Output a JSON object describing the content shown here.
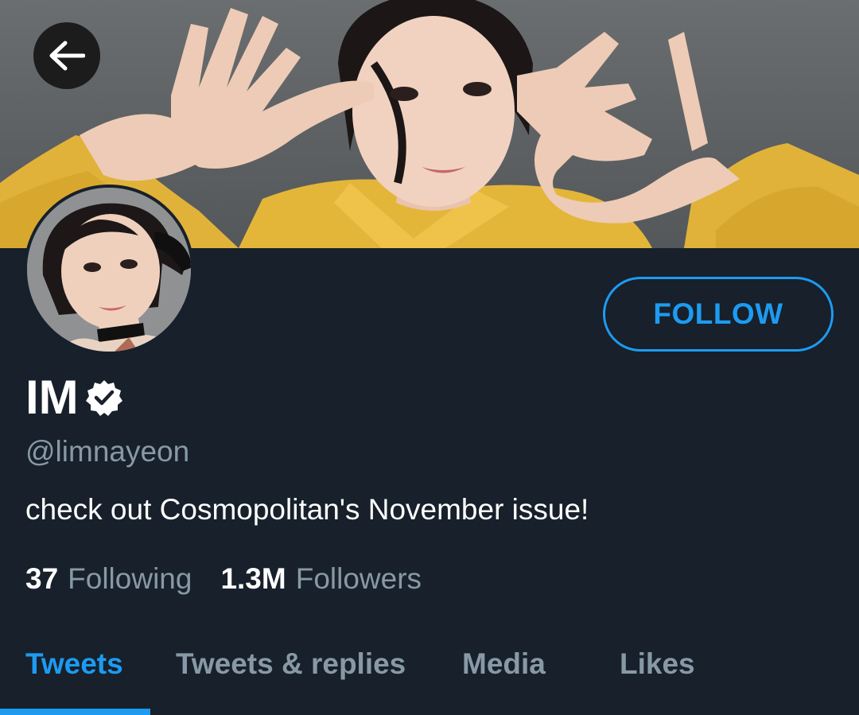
{
  "header": {
    "back_icon": "arrow-left-icon"
  },
  "profile": {
    "display_name": "IM",
    "verified_icon": "verified-badge-icon",
    "handle": "@limnayeon",
    "bio": "check out Cosmopolitan's November issue!",
    "follow_label": "FOLLOW"
  },
  "stats": {
    "following_count": "37",
    "following_label": "Following",
    "followers_count": "1.3M",
    "followers_label": "Followers"
  },
  "tabs": [
    {
      "label": "Tweets",
      "active": true
    },
    {
      "label": "Tweets & replies",
      "active": false
    },
    {
      "label": "Media",
      "active": false
    },
    {
      "label": "Likes",
      "active": false
    }
  ],
  "colors": {
    "background": "#17202b",
    "accent": "#1d9bf0",
    "secondary_text": "#8899a6",
    "primary_text": "#ffffff"
  }
}
